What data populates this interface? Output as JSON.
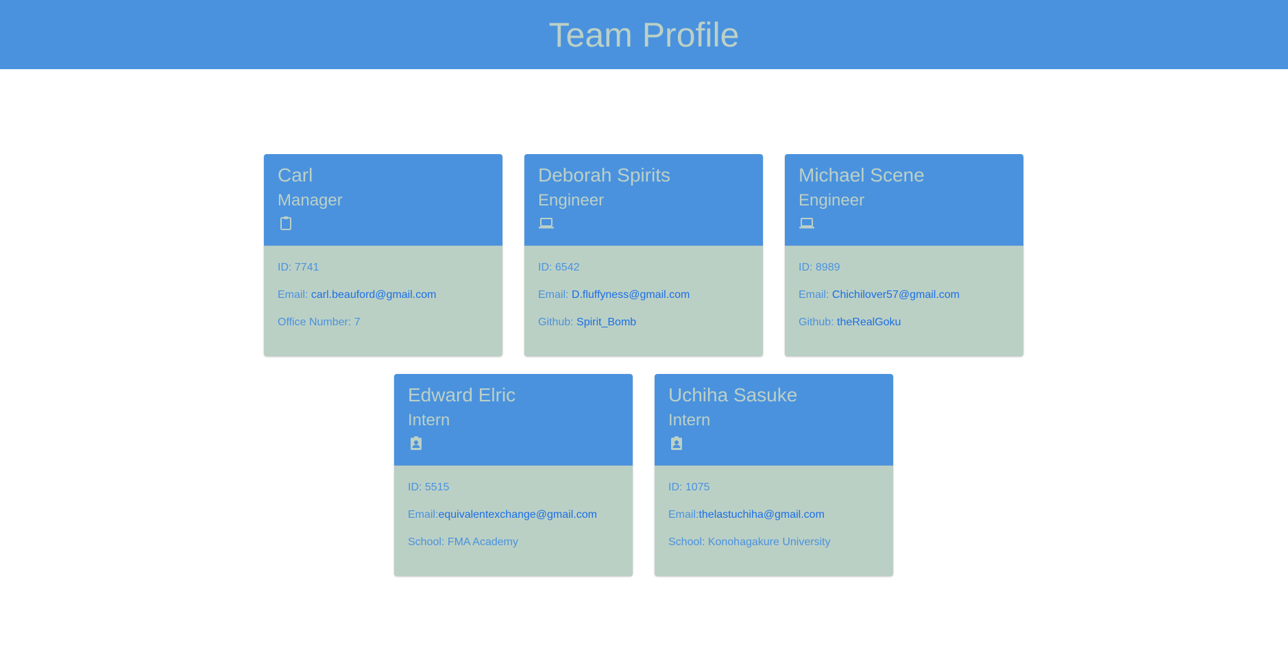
{
  "header": {
    "title": "Team Profile"
  },
  "colors": {
    "header_bg": "#4a92de",
    "header_text": "#bcd0c6",
    "card_body_bg": "#bbd0c5",
    "link": "#1b6fe6"
  },
  "cards": [
    {
      "name": "Carl",
      "role": "Manager",
      "icon": "clipboard-icon",
      "id_label": "ID: 7741",
      "email_label": "Email: ",
      "email": "carl.beauford@gmail.com",
      "extra_label": "Office Number: 7",
      "extra_link": ""
    },
    {
      "name": "Deborah Spirits",
      "role": "Engineer",
      "icon": "laptop-icon",
      "id_label": "ID: 6542",
      "email_label": "Email: ",
      "email": "D.fluffyness@gmail.com",
      "extra_label": "Github: ",
      "extra_link": "Spirit_Bomb"
    },
    {
      "name": "Michael Scene",
      "role": "Engineer",
      "icon": "laptop-icon",
      "id_label": "ID: 8989",
      "email_label": "Email: ",
      "email": "Chichilover57@gmail.com",
      "extra_label": "Github: ",
      "extra_link": "theRealGoku"
    },
    {
      "name": "Edward Elric",
      "role": "Intern",
      "icon": "badge-icon",
      "id_label": "ID: 5515",
      "email_label": "Email:",
      "email": "equivalentexchange@gmail.com",
      "extra_label": "School: FMA Academy",
      "extra_link": ""
    },
    {
      "name": "Uchiha Sasuke",
      "role": "Intern",
      "icon": "badge-icon",
      "id_label": "ID: 1075",
      "email_label": "Email:",
      "email": "thelastuchiha@gmail.com",
      "extra_label": "School: Konohagakure University",
      "extra_link": ""
    }
  ]
}
